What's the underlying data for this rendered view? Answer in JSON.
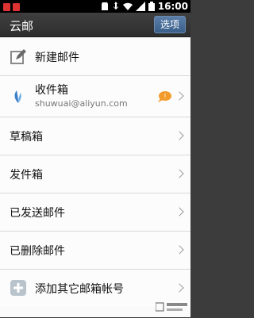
{
  "status_bar": {
    "time": "16:00",
    "icons": [
      "notification-icon",
      "notification-icon",
      "sd-card-icon",
      "usb-icon",
      "wifi-icon",
      "signal-icon",
      "battery-icon"
    ]
  },
  "header": {
    "title": "云邮",
    "options_label": "选项"
  },
  "menu": {
    "compose": "新建邮件",
    "inbox": {
      "label": "收件箱",
      "account": "shuwuai@aliyun.com",
      "badge_icon": "unread-bubble-icon"
    },
    "drafts": "草稿箱",
    "outbox": "发件箱",
    "sent": "已发送邮件",
    "deleted": "已删除邮件",
    "add_account": "添加其它邮箱帐号"
  },
  "colors": {
    "accent": "#4a74a8",
    "badge": "#f29b2b",
    "panel_bg": "#fcfcfc"
  }
}
